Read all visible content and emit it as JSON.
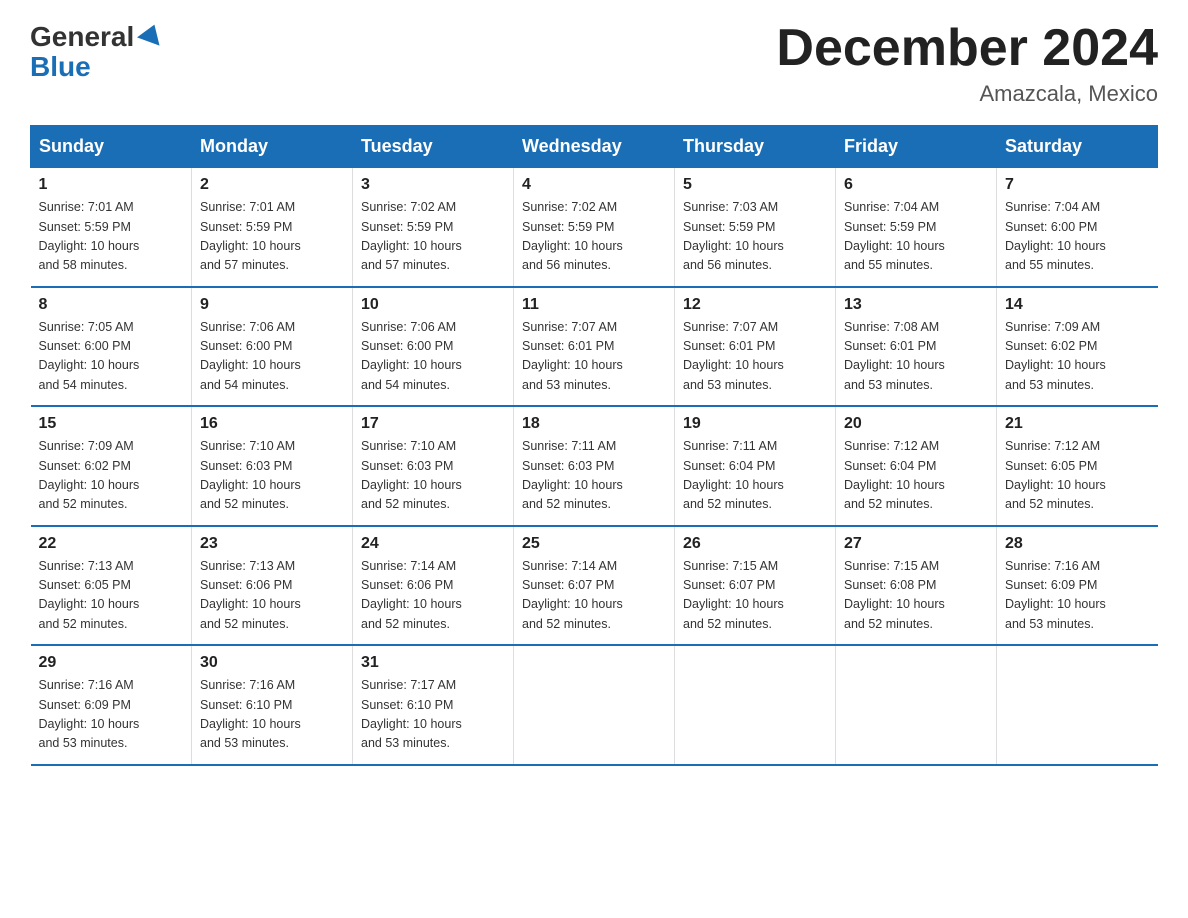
{
  "header": {
    "logo_general": "General",
    "logo_blue": "Blue",
    "title": "December 2024",
    "subtitle": "Amazcala, Mexico"
  },
  "weekdays": [
    "Sunday",
    "Monday",
    "Tuesday",
    "Wednesday",
    "Thursday",
    "Friday",
    "Saturday"
  ],
  "weeks": [
    [
      {
        "day": "1",
        "sunrise": "7:01 AM",
        "sunset": "5:59 PM",
        "daylight": "10 hours and 58 minutes."
      },
      {
        "day": "2",
        "sunrise": "7:01 AM",
        "sunset": "5:59 PM",
        "daylight": "10 hours and 57 minutes."
      },
      {
        "day": "3",
        "sunrise": "7:02 AM",
        "sunset": "5:59 PM",
        "daylight": "10 hours and 57 minutes."
      },
      {
        "day": "4",
        "sunrise": "7:02 AM",
        "sunset": "5:59 PM",
        "daylight": "10 hours and 56 minutes."
      },
      {
        "day": "5",
        "sunrise": "7:03 AM",
        "sunset": "5:59 PM",
        "daylight": "10 hours and 56 minutes."
      },
      {
        "day": "6",
        "sunrise": "7:04 AM",
        "sunset": "5:59 PM",
        "daylight": "10 hours and 55 minutes."
      },
      {
        "day": "7",
        "sunrise": "7:04 AM",
        "sunset": "6:00 PM",
        "daylight": "10 hours and 55 minutes."
      }
    ],
    [
      {
        "day": "8",
        "sunrise": "7:05 AM",
        "sunset": "6:00 PM",
        "daylight": "10 hours and 54 minutes."
      },
      {
        "day": "9",
        "sunrise": "7:06 AM",
        "sunset": "6:00 PM",
        "daylight": "10 hours and 54 minutes."
      },
      {
        "day": "10",
        "sunrise": "7:06 AM",
        "sunset": "6:00 PM",
        "daylight": "10 hours and 54 minutes."
      },
      {
        "day": "11",
        "sunrise": "7:07 AM",
        "sunset": "6:01 PM",
        "daylight": "10 hours and 53 minutes."
      },
      {
        "day": "12",
        "sunrise": "7:07 AM",
        "sunset": "6:01 PM",
        "daylight": "10 hours and 53 minutes."
      },
      {
        "day": "13",
        "sunrise": "7:08 AM",
        "sunset": "6:01 PM",
        "daylight": "10 hours and 53 minutes."
      },
      {
        "day": "14",
        "sunrise": "7:09 AM",
        "sunset": "6:02 PM",
        "daylight": "10 hours and 53 minutes."
      }
    ],
    [
      {
        "day": "15",
        "sunrise": "7:09 AM",
        "sunset": "6:02 PM",
        "daylight": "10 hours and 52 minutes."
      },
      {
        "day": "16",
        "sunrise": "7:10 AM",
        "sunset": "6:03 PM",
        "daylight": "10 hours and 52 minutes."
      },
      {
        "day": "17",
        "sunrise": "7:10 AM",
        "sunset": "6:03 PM",
        "daylight": "10 hours and 52 minutes."
      },
      {
        "day": "18",
        "sunrise": "7:11 AM",
        "sunset": "6:03 PM",
        "daylight": "10 hours and 52 minutes."
      },
      {
        "day": "19",
        "sunrise": "7:11 AM",
        "sunset": "6:04 PM",
        "daylight": "10 hours and 52 minutes."
      },
      {
        "day": "20",
        "sunrise": "7:12 AM",
        "sunset": "6:04 PM",
        "daylight": "10 hours and 52 minutes."
      },
      {
        "day": "21",
        "sunrise": "7:12 AM",
        "sunset": "6:05 PM",
        "daylight": "10 hours and 52 minutes."
      }
    ],
    [
      {
        "day": "22",
        "sunrise": "7:13 AM",
        "sunset": "6:05 PM",
        "daylight": "10 hours and 52 minutes."
      },
      {
        "day": "23",
        "sunrise": "7:13 AM",
        "sunset": "6:06 PM",
        "daylight": "10 hours and 52 minutes."
      },
      {
        "day": "24",
        "sunrise": "7:14 AM",
        "sunset": "6:06 PM",
        "daylight": "10 hours and 52 minutes."
      },
      {
        "day": "25",
        "sunrise": "7:14 AM",
        "sunset": "6:07 PM",
        "daylight": "10 hours and 52 minutes."
      },
      {
        "day": "26",
        "sunrise": "7:15 AM",
        "sunset": "6:07 PM",
        "daylight": "10 hours and 52 minutes."
      },
      {
        "day": "27",
        "sunrise": "7:15 AM",
        "sunset": "6:08 PM",
        "daylight": "10 hours and 52 minutes."
      },
      {
        "day": "28",
        "sunrise": "7:16 AM",
        "sunset": "6:09 PM",
        "daylight": "10 hours and 53 minutes."
      }
    ],
    [
      {
        "day": "29",
        "sunrise": "7:16 AM",
        "sunset": "6:09 PM",
        "daylight": "10 hours and 53 minutes."
      },
      {
        "day": "30",
        "sunrise": "7:16 AM",
        "sunset": "6:10 PM",
        "daylight": "10 hours and 53 minutes."
      },
      {
        "day": "31",
        "sunrise": "7:17 AM",
        "sunset": "6:10 PM",
        "daylight": "10 hours and 53 minutes."
      },
      null,
      null,
      null,
      null
    ]
  ],
  "labels": {
    "sunrise_prefix": "Sunrise: ",
    "sunset_prefix": "Sunset: ",
    "daylight_prefix": "Daylight: "
  }
}
